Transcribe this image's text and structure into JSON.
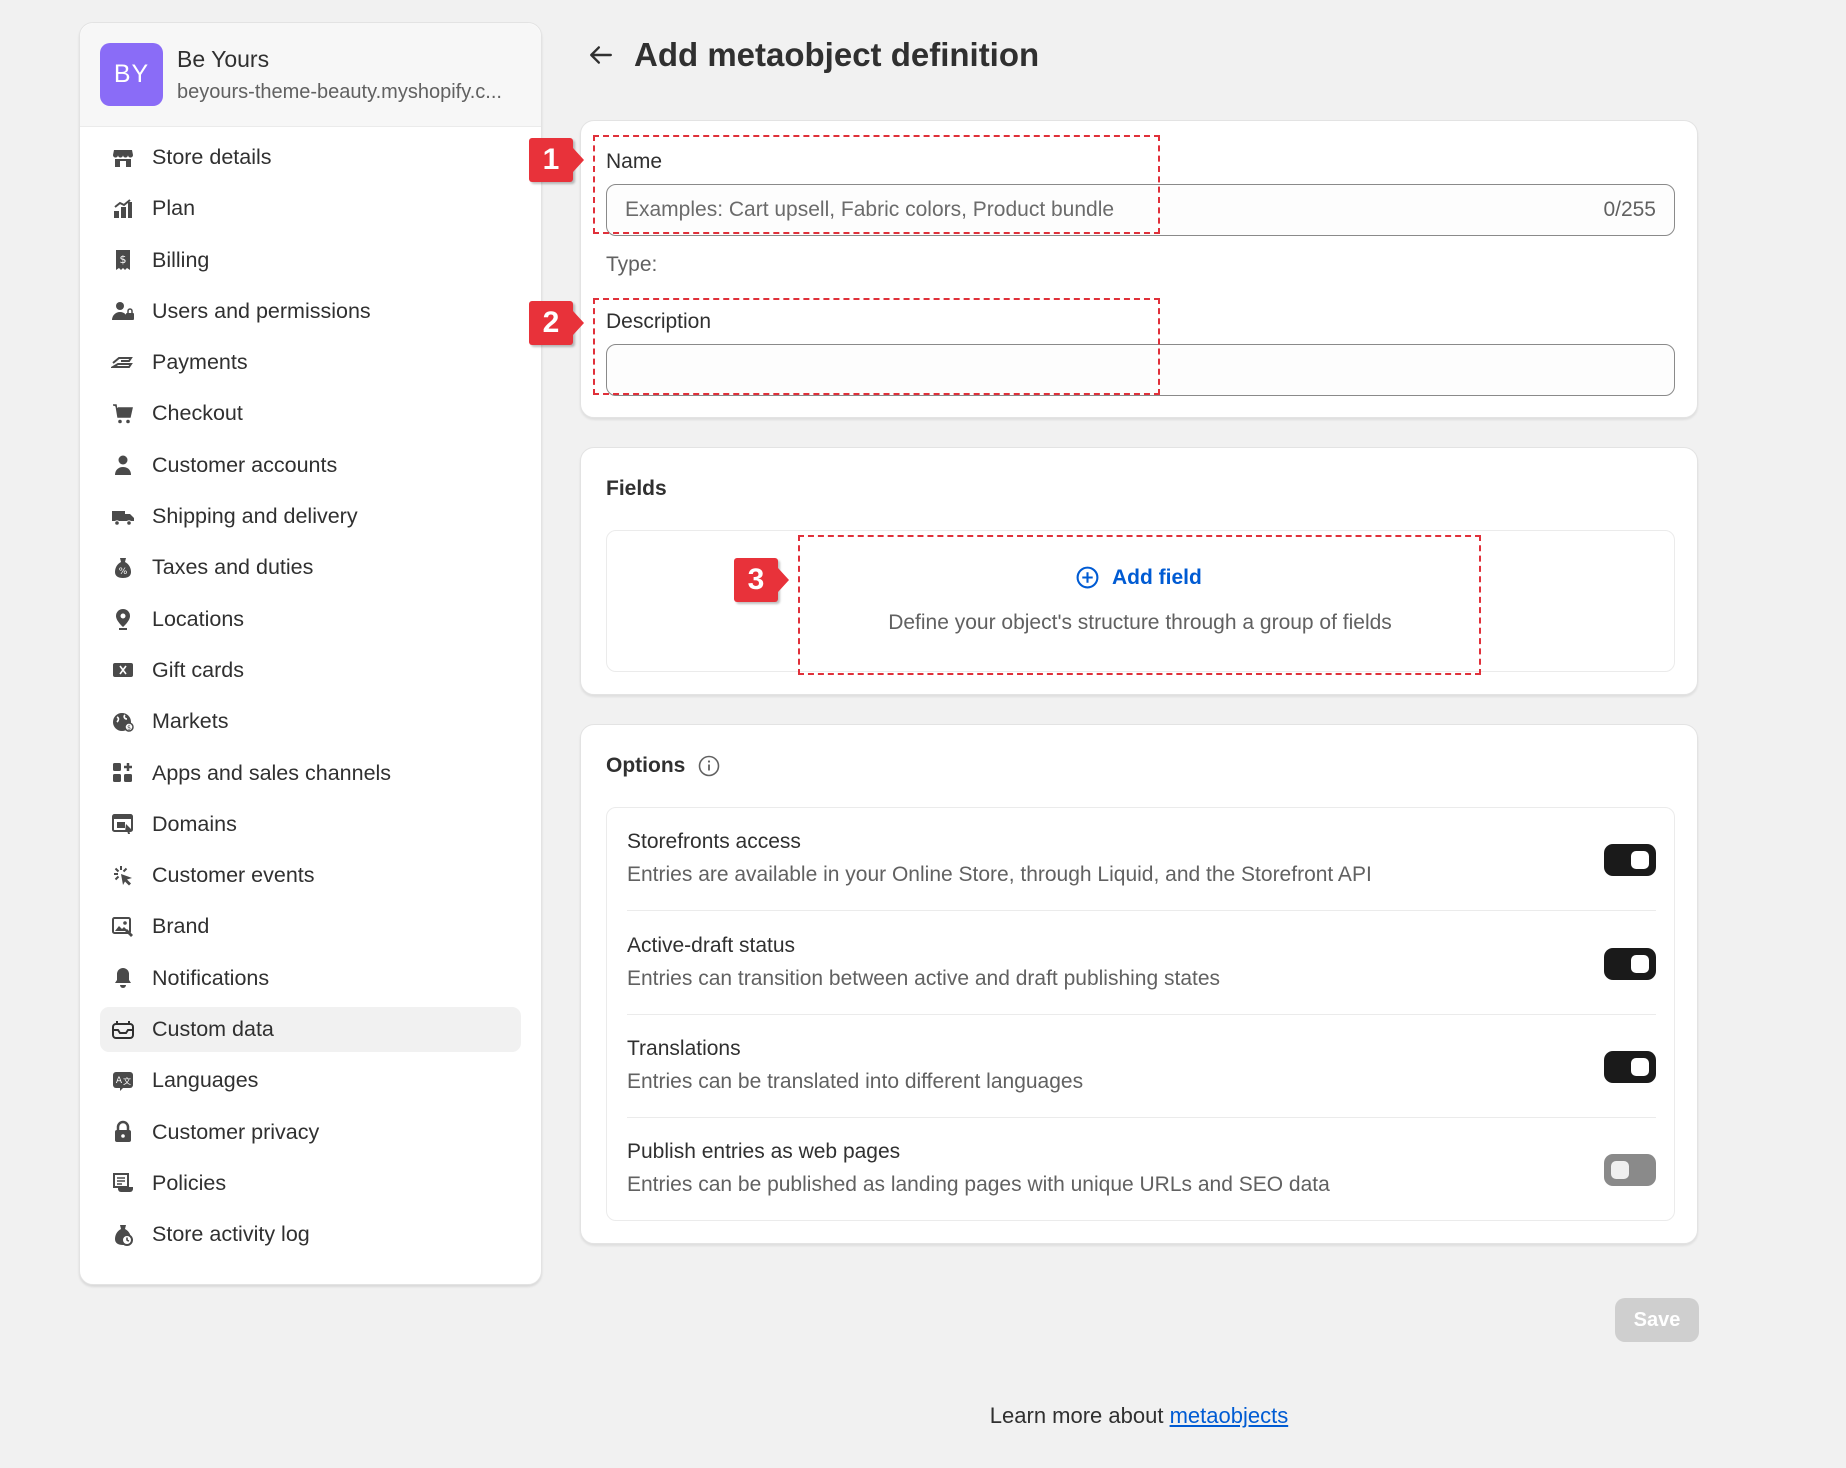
{
  "store": {
    "initials": "BY",
    "name": "Be Yours",
    "url": "beyours-theme-beauty.myshopify.c...",
    "avatar_color": "#8a6cf7"
  },
  "sidebar": {
    "items": [
      {
        "label": "Store details",
        "icon": "store-icon"
      },
      {
        "label": "Plan",
        "icon": "plan-icon"
      },
      {
        "label": "Billing",
        "icon": "billing-icon"
      },
      {
        "label": "Users and permissions",
        "icon": "users-icon"
      },
      {
        "label": "Payments",
        "icon": "payments-icon"
      },
      {
        "label": "Checkout",
        "icon": "cart-icon"
      },
      {
        "label": "Customer accounts",
        "icon": "person-icon"
      },
      {
        "label": "Shipping and delivery",
        "icon": "truck-icon"
      },
      {
        "label": "Taxes and duties",
        "icon": "tax-icon"
      },
      {
        "label": "Locations",
        "icon": "location-pin-icon"
      },
      {
        "label": "Gift cards",
        "icon": "gift-card-icon"
      },
      {
        "label": "Markets",
        "icon": "globe-icon"
      },
      {
        "label": "Apps and sales channels",
        "icon": "apps-icon"
      },
      {
        "label": "Domains",
        "icon": "domains-icon"
      },
      {
        "label": "Customer events",
        "icon": "cursor-click-icon"
      },
      {
        "label": "Brand",
        "icon": "brand-icon"
      },
      {
        "label": "Notifications",
        "icon": "bell-icon"
      },
      {
        "label": "Custom data",
        "icon": "custom-data-icon",
        "active": true
      },
      {
        "label": "Languages",
        "icon": "language-icon"
      },
      {
        "label": "Customer privacy",
        "icon": "lock-icon"
      },
      {
        "label": "Policies",
        "icon": "policies-icon"
      },
      {
        "label": "Store activity log",
        "icon": "activity-log-icon"
      }
    ]
  },
  "page": {
    "title": "Add metaobject definition",
    "back_icon": "arrow-left-icon"
  },
  "definition": {
    "name_label": "Name",
    "name_placeholder": "Examples: Cart upsell, Fabric colors, Product bundle",
    "name_count": "0/255",
    "type_label": "Type:",
    "description_label": "Description",
    "description_value": ""
  },
  "fields": {
    "title": "Fields",
    "add_label": "Add field",
    "help_text": "Define your object's structure through a group of fields"
  },
  "options": {
    "title": "Options",
    "items": [
      {
        "title": "Storefronts access",
        "description": "Entries are available in your Online Store, through Liquid, and the Storefront API",
        "enabled": true
      },
      {
        "title": "Active-draft status",
        "description": "Entries can transition between active and draft publishing states",
        "enabled": true
      },
      {
        "title": "Translations",
        "description": "Entries can be translated into different languages",
        "enabled": true
      },
      {
        "title": "Publish entries as web pages",
        "description": "Entries can be published as landing pages with unique URLs and SEO data",
        "enabled": false
      }
    ]
  },
  "annotations": [
    "1",
    "2",
    "3"
  ],
  "footer": {
    "save_label": "Save",
    "learn_more_prefix": "Learn more about",
    "learn_more_link": "metaobjects"
  },
  "colors": {
    "accent": "#005bd3",
    "annotation": "#e8323a",
    "toggle_on": "#1a1a1a",
    "toggle_off": "#8a8a8a"
  }
}
